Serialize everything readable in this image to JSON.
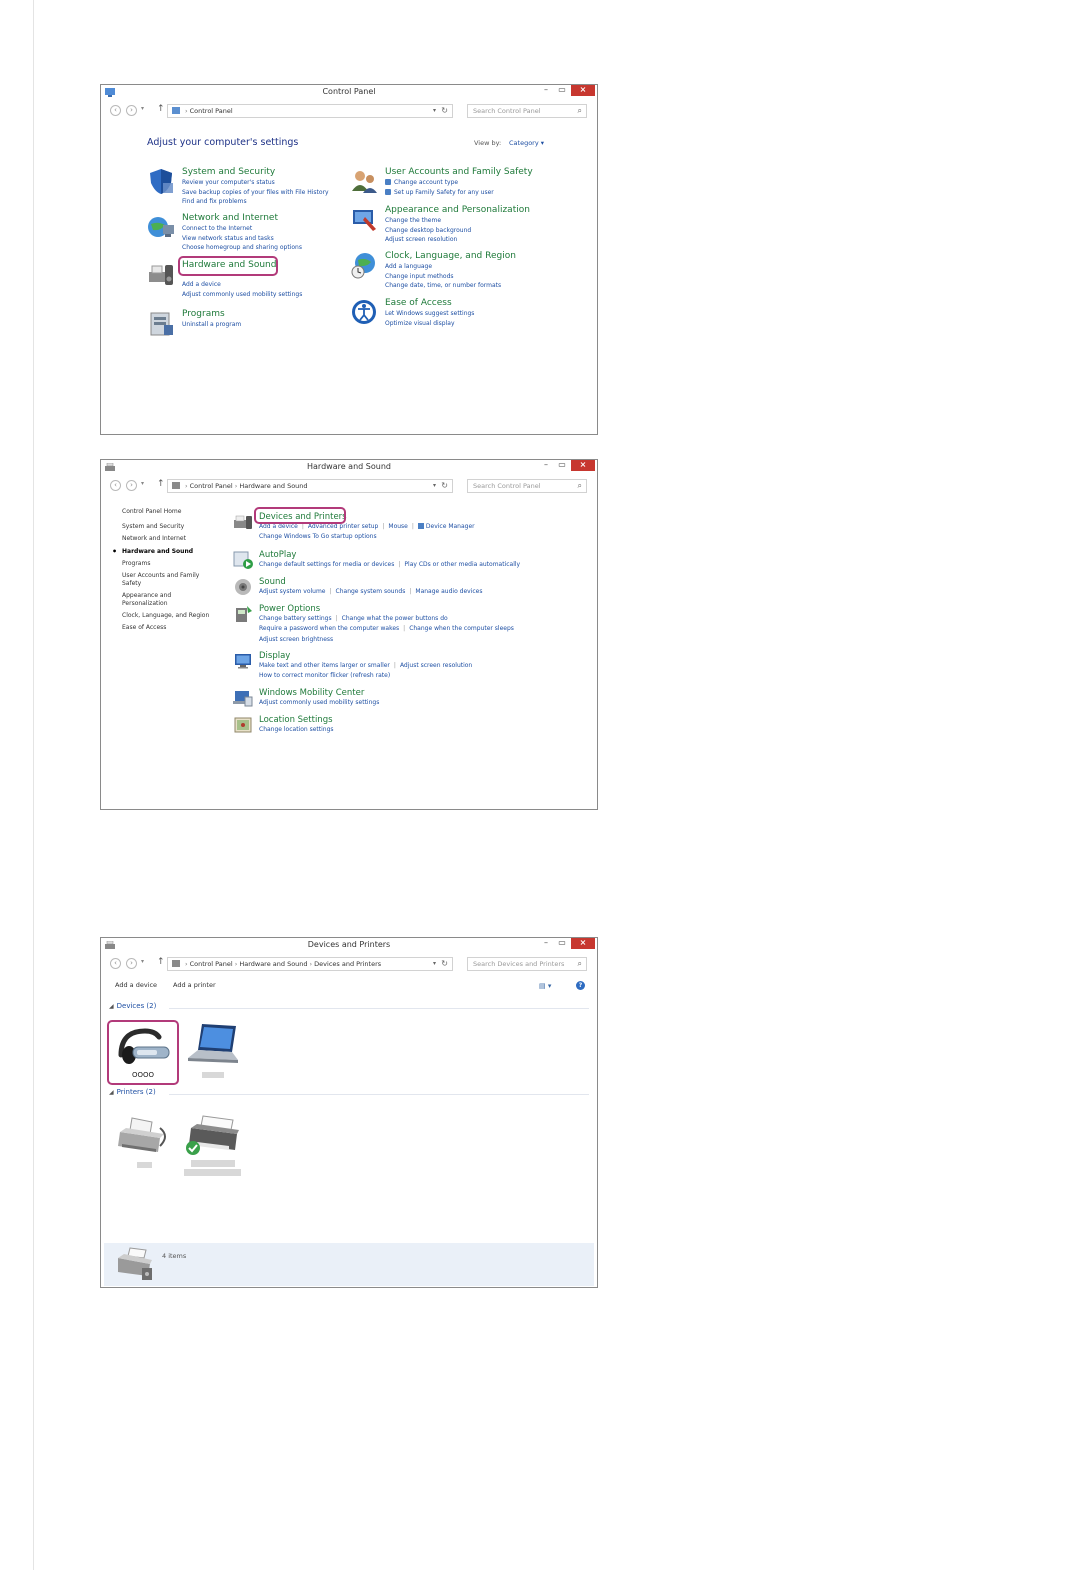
{
  "window1": {
    "title": "Control Panel",
    "address": [
      "Control Panel"
    ],
    "search_placeholder": "Search Control Panel",
    "heading": "Adjust your computer's settings",
    "view_by_label": "View by:",
    "view_by_value": "Category ▾",
    "categories": [
      {
        "title": "System and Security",
        "links": [
          "Review your computer's status",
          "Save backup copies of your files with File History",
          "Find and fix problems"
        ]
      },
      {
        "title": "Network and Internet",
        "links": [
          "Connect to the Internet",
          "View network status and tasks",
          "Choose homegroup and sharing options"
        ]
      },
      {
        "title": "Hardware and Sound",
        "links": [
          "Add a device",
          "Adjust commonly used mobility settings"
        ]
      },
      {
        "title": "Programs",
        "links": [
          "Uninstall a program"
        ]
      },
      {
        "title": "User Accounts and Family Safety",
        "links": [
          "Change account type",
          "Set up Family Safety for any user"
        ]
      },
      {
        "title": "Appearance and Personalization",
        "links": [
          "Change the theme",
          "Change desktop background",
          "Adjust screen resolution"
        ]
      },
      {
        "title": "Clock, Language, and Region",
        "links": [
          "Add a language",
          "Change input methods",
          "Change date, time, or number formats"
        ]
      },
      {
        "title": "Ease of Access",
        "links": [
          "Let Windows suggest settings",
          "Optimize visual display"
        ]
      }
    ]
  },
  "window2": {
    "title": "Hardware and Sound",
    "address": [
      "Control Panel",
      "Hardware and Sound"
    ],
    "search_placeholder": "Search Control Panel",
    "sidebar": [
      "Control Panel Home",
      "System and Security",
      "Network and Internet",
      "Hardware and Sound",
      "Programs",
      "User Accounts and Family",
      "Safety",
      "Appearance and",
      "Personalization",
      "Clock, Language, and Region",
      "Ease of Access"
    ],
    "sections": [
      {
        "title": "Devices and Printers",
        "lines": [
          [
            "Add a device",
            "Advanced printer setup",
            "Mouse",
            "Device Manager"
          ],
          [
            "Change Windows To Go startup options"
          ]
        ]
      },
      {
        "title": "AutoPlay",
        "lines": [
          [
            "Change default settings for media or devices",
            "Play CDs or other media automatically"
          ]
        ]
      },
      {
        "title": "Sound",
        "lines": [
          [
            "Adjust system volume",
            "Change system sounds",
            "Manage audio devices"
          ]
        ]
      },
      {
        "title": "Power Options",
        "lines": [
          [
            "Change battery settings",
            "Change what the power buttons do"
          ],
          [
            "Require a password when the computer wakes",
            "Change when the computer sleeps"
          ],
          [
            "Adjust screen brightness"
          ]
        ]
      },
      {
        "title": "Display",
        "lines": [
          [
            "Make text and other items larger or smaller",
            "Adjust screen resolution"
          ],
          [
            "How to correct monitor flicker (refresh rate)"
          ]
        ]
      },
      {
        "title": "Windows Mobility Center",
        "lines": [
          [
            "Adjust commonly used mobility settings"
          ]
        ]
      },
      {
        "title": "Location Settings",
        "lines": [
          [
            "Change location settings"
          ]
        ]
      }
    ]
  },
  "window3": {
    "title": "Devices and Printers",
    "address": [
      "Control Panel",
      "Hardware and Sound",
      "Devices and Printers"
    ],
    "search_placeholder": "Search Devices and Printers",
    "toolbar": {
      "add_device": "Add a device",
      "add_printer": "Add a printer",
      "view_icon": "view-icon",
      "help_icon": "?"
    },
    "devices_group": "Devices (2)",
    "printers_group": "Printers (2)",
    "headset_label": "OOOO",
    "status_text": "4 items"
  }
}
